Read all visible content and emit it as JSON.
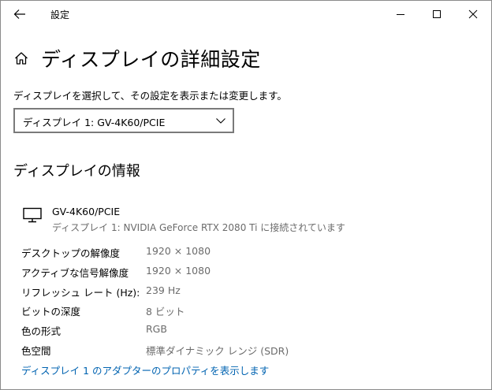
{
  "window": {
    "title": "設定"
  },
  "page": {
    "title": "ディスプレイの詳細設定"
  },
  "select": {
    "label": "ディスプレイを選択して、その設定を表示または変更します。",
    "value": "ディスプレイ 1: GV-4K60/PCIE"
  },
  "info": {
    "section_title": "ディスプレイの情報",
    "device_name": "GV-4K60/PCIE",
    "device_subtitle": "ディスプレイ 1: NVIDIA GeForce RTX 2080 Ti に接続されています",
    "rows": [
      {
        "label": "デスクトップの解像度",
        "value": "1920 × 1080"
      },
      {
        "label": "アクティブな信号解像度",
        "value": "1920 × 1080"
      },
      {
        "label": "リフレッシュ レート (Hz):",
        "value": "239 Hz"
      },
      {
        "label": "ビットの深度",
        "value": "8 ビット"
      },
      {
        "label": "色の形式",
        "value": "RGB"
      },
      {
        "label": "色空間",
        "value": "標準ダイナミック レンジ (SDR)"
      }
    ],
    "adapter_link": "ディスプレイ 1 のアダプターのプロパティを表示します"
  },
  "icons": {
    "back": "back-arrow-icon",
    "home": "home-icon",
    "minimize": "minimize-icon",
    "maximize": "maximize-icon",
    "close": "close-icon",
    "dropdown": "chevron-down-icon",
    "monitor": "monitor-icon"
  },
  "colors": {
    "link": "#0063b1",
    "secondary_text": "#6b6b6b",
    "select_border": "#7a7a7a"
  }
}
